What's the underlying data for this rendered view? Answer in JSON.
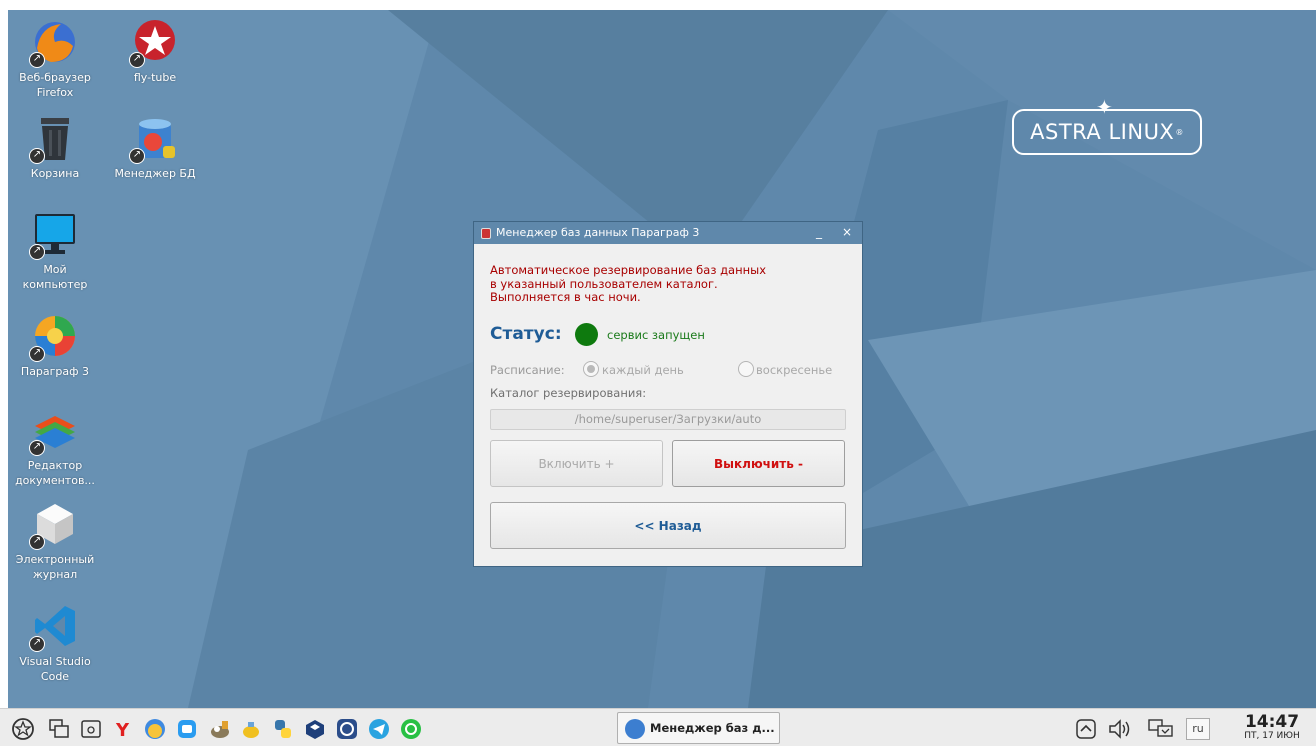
{
  "desktop": {
    "logo_text": "ASTRA LINUX",
    "icons": [
      {
        "label_line1": "Веб-браузер",
        "label_line2": "Firefox"
      },
      {
        "label_line1": "fly-tube",
        "label_line2": ""
      },
      {
        "label_line1": "Корзина",
        "label_line2": ""
      },
      {
        "label_line1": "Менеджер БД",
        "label_line2": ""
      },
      {
        "label_line1": "Мой",
        "label_line2": "компьютер"
      },
      {
        "label_line1": "Параграф 3",
        "label_line2": ""
      },
      {
        "label_line1": "Редактор",
        "label_line2": "документов..."
      },
      {
        "label_line1": "Электронный",
        "label_line2": "журнал"
      },
      {
        "label_line1": "Visual Studio",
        "label_line2": "Code"
      }
    ]
  },
  "dialog": {
    "title": "Менеджер баз данных Параграф 3",
    "minimize": "_",
    "close": "×",
    "description": [
      "Автоматическое резервирование баз данных",
      "в указанный пользователем каталог.",
      "Выполняется в час ночи."
    ],
    "status_label": "Статус:",
    "status_text": "сервис запущен",
    "status_color": "#0e7a0e",
    "schedule_label": "Расписание:",
    "schedule_options": [
      "каждый день",
      "воскресенье"
    ],
    "schedule_selected": "каждый день",
    "catalog_label": "Каталог резервирования:",
    "catalog_path": "/home/superuser/Загрузки/auto",
    "enable_button": "Включить +",
    "disable_button": "Выключить -",
    "back_button": "<< Назад"
  },
  "taskbar": {
    "launchers": [
      "start-menu-icon",
      "desktop-icon",
      "file-manager-icon",
      "yandex-browser-icon",
      "chat-icon",
      "messenger-icon",
      "gimp-icon",
      "tea-icon",
      "python-icon",
      "virtualbox-icon",
      "clock-app-icon",
      "telegram-icon",
      "whatsapp-icon"
    ],
    "active_task": "Менеджер баз д...",
    "language": "ru",
    "time": "14:47",
    "date": "ПТ, 17 ИЮН"
  },
  "colors": {
    "wallpaper": "#5f88ab",
    "accent_blue": "#1f5c96",
    "warning_red": "#a80000",
    "disable_red": "#d01010"
  }
}
